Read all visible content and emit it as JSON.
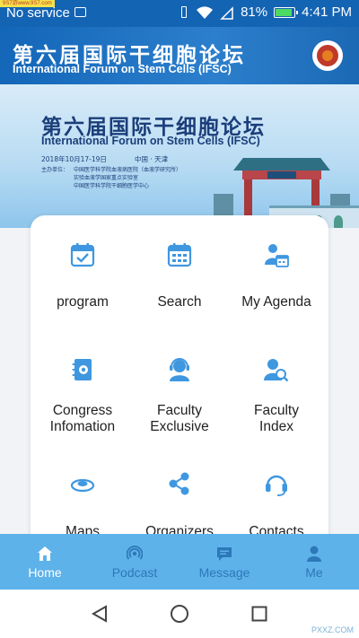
{
  "status_bar": {
    "watermark": "9S7游www.9S7.com",
    "carrier": "No service",
    "battery": "81%",
    "time": "4:41 PM",
    "battery_level": 0.81
  },
  "header": {
    "title_cn": "第六届国际干细胞论坛",
    "title_en": "International Forum on Stem Cells (IFSC)"
  },
  "banner": {
    "title_cn": "第六届国际干细胞论坛",
    "title_en": "International Forum on Stem Cells (IFSC)",
    "date": "2018年10月17-19日",
    "location": "中国 · 天津",
    "organizer_label": "主办单位：",
    "organizers": [
      "中国医学科学院血液病医院（血液学研究所）",
      "实验血液学国家重点实验室",
      "中国医学科学院干细胞医学中心"
    ]
  },
  "menu": {
    "items": [
      {
        "label": "program",
        "icon": "calendar-check-icon"
      },
      {
        "label": "Search",
        "icon": "calendar-grid-icon"
      },
      {
        "label": "My Agenda",
        "icon": "user-calendar-icon"
      },
      {
        "label": "Congress\nInfomation",
        "icon": "booklet-icon"
      },
      {
        "label": "Faculty\nExclusive",
        "icon": "headset-person-icon"
      },
      {
        "label": "Faculty\nIndex",
        "icon": "person-search-icon"
      },
      {
        "label": "Maps",
        "icon": "map-pin-icon"
      },
      {
        "label": "Organizers",
        "icon": "share-icon"
      },
      {
        "label": "Contacts",
        "icon": "headphones-icon"
      }
    ]
  },
  "bottom_nav": {
    "tabs": [
      {
        "label": "Home",
        "icon": "home-icon",
        "active": true
      },
      {
        "label": "Podcast",
        "icon": "podcast-icon",
        "active": false
      },
      {
        "label": "Message",
        "icon": "message-icon",
        "active": false
      },
      {
        "label": "Me",
        "icon": "person-icon",
        "active": false
      }
    ]
  },
  "watermark_bottom": "PXXZ.COM",
  "colors": {
    "accent": "#3f97e0",
    "status_bar": "#1464b4",
    "bottom_nav": "#5eb2ea"
  }
}
